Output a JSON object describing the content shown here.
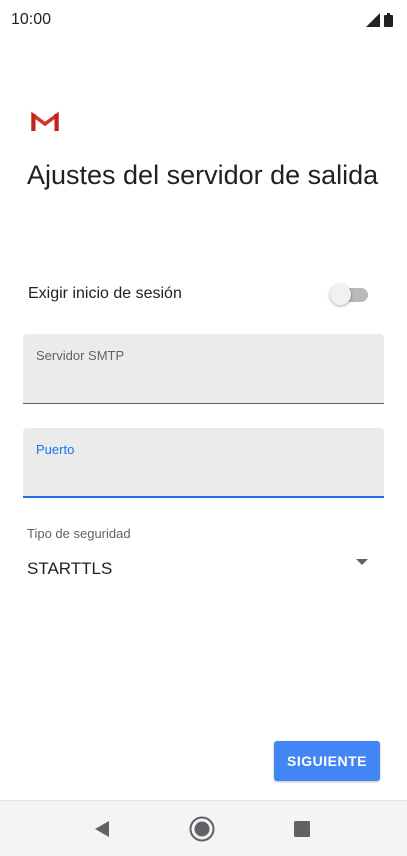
{
  "status_bar": {
    "time": "10:00",
    "icons": [
      "signal-icon",
      "battery-icon"
    ]
  },
  "app": {
    "logo_icon": "gmail-logo",
    "brand_color": "#d93025"
  },
  "page": {
    "title": "Ajustes del servidor de salida"
  },
  "login_toggle": {
    "label": "Exigir inicio de sesión",
    "checked": false
  },
  "fields": {
    "smtp": {
      "label": "Servidor SMTP",
      "value": ""
    },
    "port": {
      "label": "Puerto",
      "value": "",
      "focused": true
    }
  },
  "security": {
    "label": "Tipo de seguridad",
    "selected": "STARTTLS"
  },
  "buttons": {
    "next": "SIGUIENTE"
  },
  "nav_bar": {
    "icons": [
      "back-icon",
      "home-icon",
      "recents-icon"
    ]
  },
  "colors": {
    "accent": "#1a73e8",
    "button": "#4285f4"
  }
}
